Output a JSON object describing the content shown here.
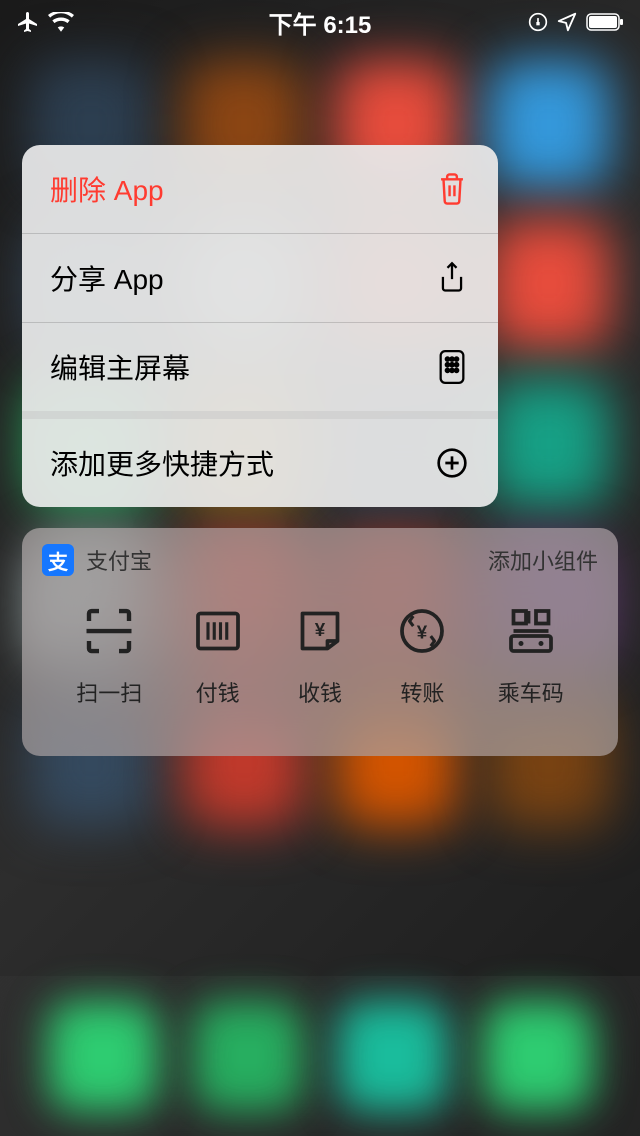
{
  "status_bar": {
    "time": "下午 6:15"
  },
  "context_menu": {
    "items": [
      {
        "label": "删除 App",
        "icon": "trash-icon",
        "destructive": true
      },
      {
        "label": "分享 App",
        "icon": "share-icon"
      },
      {
        "label": "编辑主屏幕",
        "icon": "apps-icon"
      }
    ],
    "secondary_items": [
      {
        "label": "添加更多快捷方式",
        "icon": "plus-circle-icon"
      }
    ]
  },
  "widget": {
    "app_icon_text": "支",
    "app_name": "支付宝",
    "add_widget_label": "添加小组件",
    "actions": [
      {
        "label": "扫一扫",
        "icon": "scan"
      },
      {
        "label": "付钱",
        "icon": "barcode"
      },
      {
        "label": "收钱",
        "icon": "receive"
      },
      {
        "label": "转账",
        "icon": "transfer"
      },
      {
        "label": "乘车码",
        "icon": "transit"
      }
    ]
  }
}
